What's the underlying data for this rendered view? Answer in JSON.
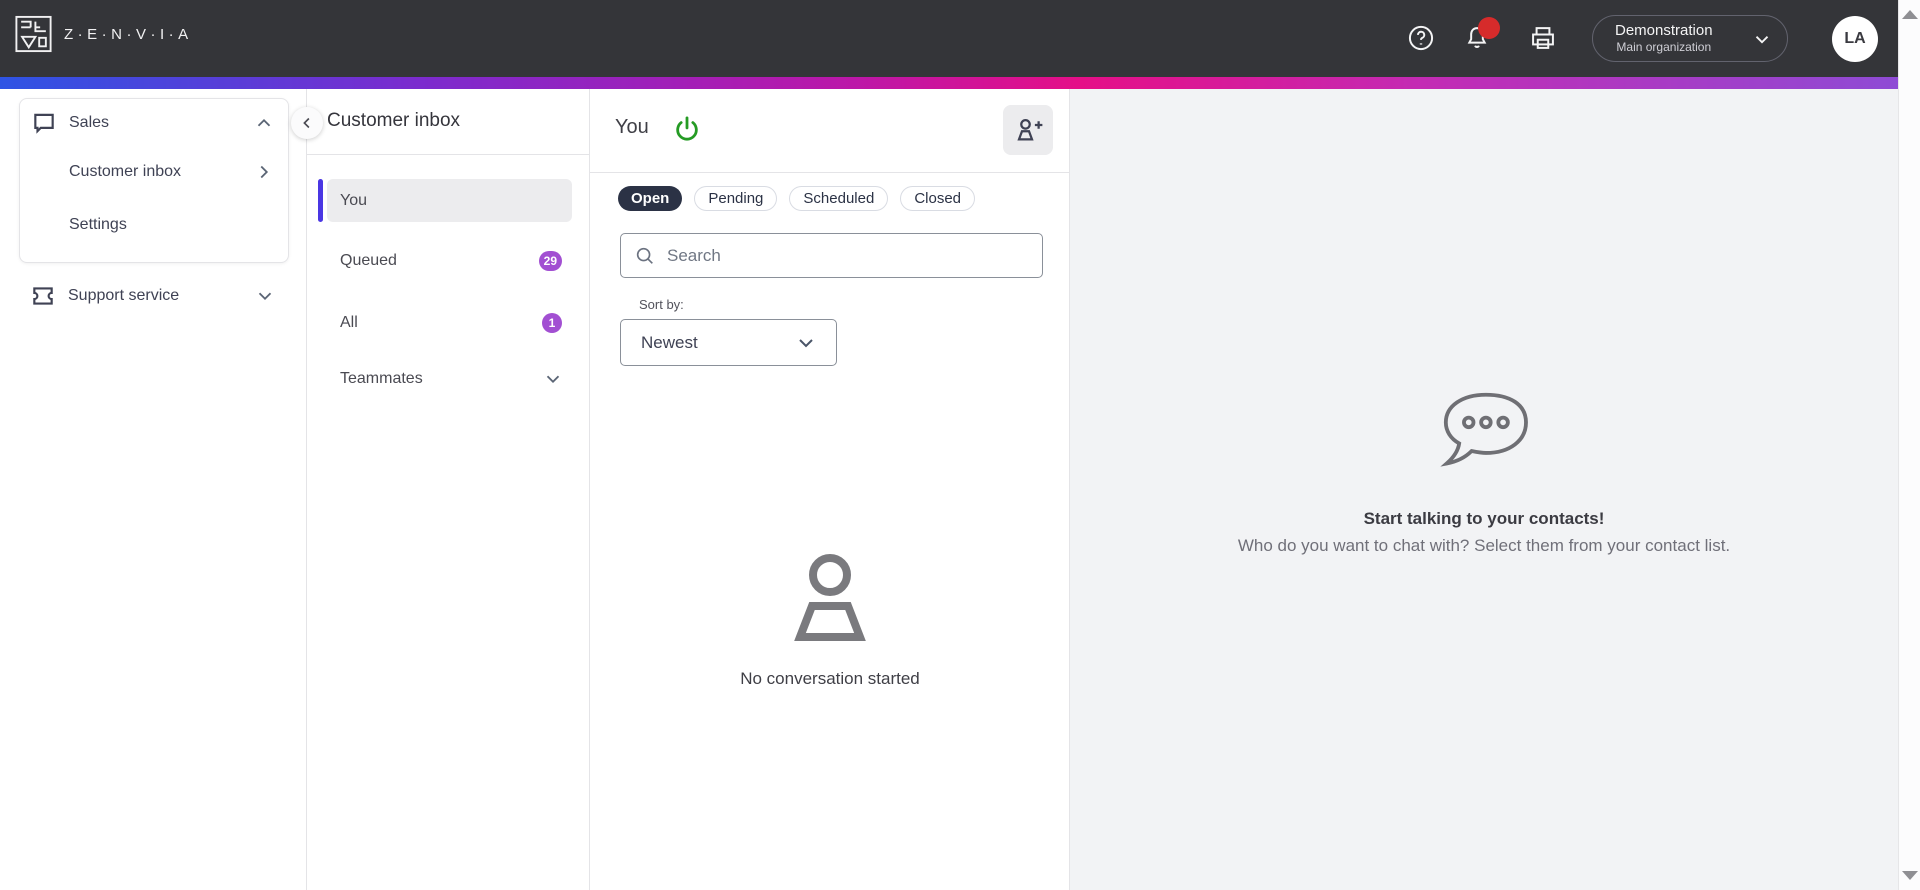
{
  "header": {
    "brand": "Z·E·N·V·I·A",
    "org": {
      "name": "Demonstration",
      "sub": "Main organization"
    },
    "avatar_initials": "LA"
  },
  "sidebar": {
    "sales": {
      "label": "Sales"
    },
    "sales_items": [
      {
        "label": "Customer inbox"
      },
      {
        "label": "Settings"
      }
    ],
    "support": {
      "label": "Support service"
    }
  },
  "inbox_panel": {
    "title": "Customer inbox",
    "items": [
      {
        "label": "You",
        "selected": true
      },
      {
        "label": "Queued",
        "badge": "29"
      },
      {
        "label": "All",
        "badge": "1"
      },
      {
        "label": "Teammates",
        "expandable": true
      }
    ]
  },
  "main": {
    "title": "You",
    "tabs": [
      {
        "label": "Open",
        "active": true
      },
      {
        "label": "Pending"
      },
      {
        "label": "Scheduled"
      },
      {
        "label": "Closed"
      }
    ],
    "search_placeholder": "Search",
    "sort_label": "Sort by:",
    "sort_value": "Newest",
    "empty_text": "No conversation started"
  },
  "right_panel": {
    "title": "Start talking to your contacts!",
    "subtitle": "Who do you want to chat with? Select them from your contact list."
  },
  "icons": {
    "topbar": [
      "help-icon",
      "bell-icon",
      "printer-icon"
    ],
    "status": "power-icon"
  },
  "colors": {
    "topbar_bg": "#343539",
    "gradient": [
      "#2e54e4",
      "#7b2bce",
      "#e50f87",
      "#8e4bd5"
    ],
    "badge_purple": "#a24fd2",
    "selected_bar_indigo": "#4a36e3",
    "power_green": "#259b24",
    "notification_red": "#d62b2b",
    "tab_active_bg": "#2b3245",
    "right_panel_bg": "#f2f3f5"
  }
}
